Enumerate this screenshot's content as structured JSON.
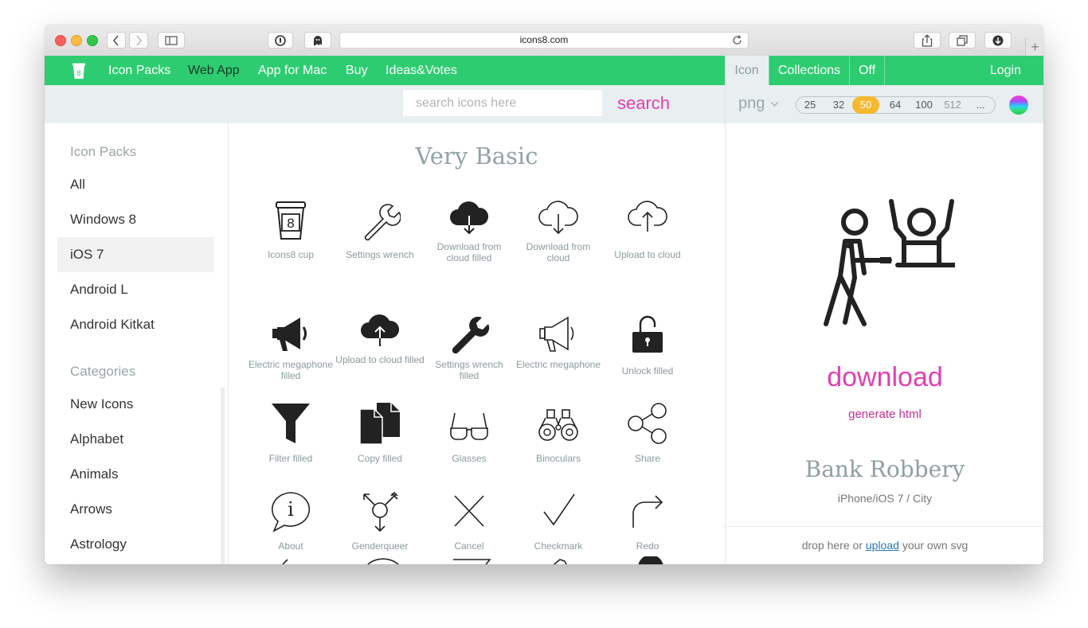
{
  "browser": {
    "url": "icons8.com"
  },
  "nav": {
    "items": [
      "Icon Packs",
      "Web App",
      "App for Mac",
      "Buy",
      "Ideas&Votes"
    ],
    "right_tabs": [
      "Icon",
      "Collections",
      "Off"
    ],
    "login": "Login"
  },
  "search": {
    "placeholder": "search icons here",
    "button": "search"
  },
  "format": {
    "value": "png",
    "sizes": [
      "25",
      "32",
      "50",
      "64",
      "100",
      "512",
      "..."
    ],
    "selected_size": "50"
  },
  "sidebar": {
    "packs_heading": "Icon Packs",
    "packs": [
      "All",
      "Windows 8",
      "iOS 7",
      "Android L",
      "Android Kitkat"
    ],
    "selected_pack": "iOS 7",
    "categories_heading": "Categories",
    "categories": [
      "New Icons",
      "Alphabet",
      "Animals",
      "Arrows",
      "Astrology"
    ]
  },
  "main": {
    "title": "Very Basic",
    "icons": [
      {
        "label": "Icons8 cup",
        "glyph": "8"
      },
      {
        "label": "Settings wrench"
      },
      {
        "label": "Download from cloud filled"
      },
      {
        "label": "Download from cloud"
      },
      {
        "label": "Upload to cloud"
      },
      {
        "label": "Electric megaphone filled"
      },
      {
        "label": "Upload to cloud filled"
      },
      {
        "label": "Settings wrench filled"
      },
      {
        "label": "Electric megaphone"
      },
      {
        "label": "Unlock filled"
      },
      {
        "label": "Filter filled"
      },
      {
        "label": "Copy filled"
      },
      {
        "label": "Glasses"
      },
      {
        "label": "Binoculars"
      },
      {
        "label": "Share"
      },
      {
        "label": "About",
        "glyph": "i"
      },
      {
        "label": "Genderqueer"
      },
      {
        "label": "Cancel"
      },
      {
        "label": "Checkmark"
      },
      {
        "label": "Redo"
      }
    ]
  },
  "panel": {
    "download": "download",
    "generate_html": "generate html",
    "icon_name": "Bank Robbery",
    "icon_meta": "iPhone/iOS 7 / City",
    "drop_prefix": "drop here or",
    "drop_link": "upload",
    "drop_suffix": "your own svg"
  },
  "colors": {
    "brand_green": "#2ecc71",
    "accent_magenta": "#e040b0",
    "selected_size": "#f5b82e"
  }
}
